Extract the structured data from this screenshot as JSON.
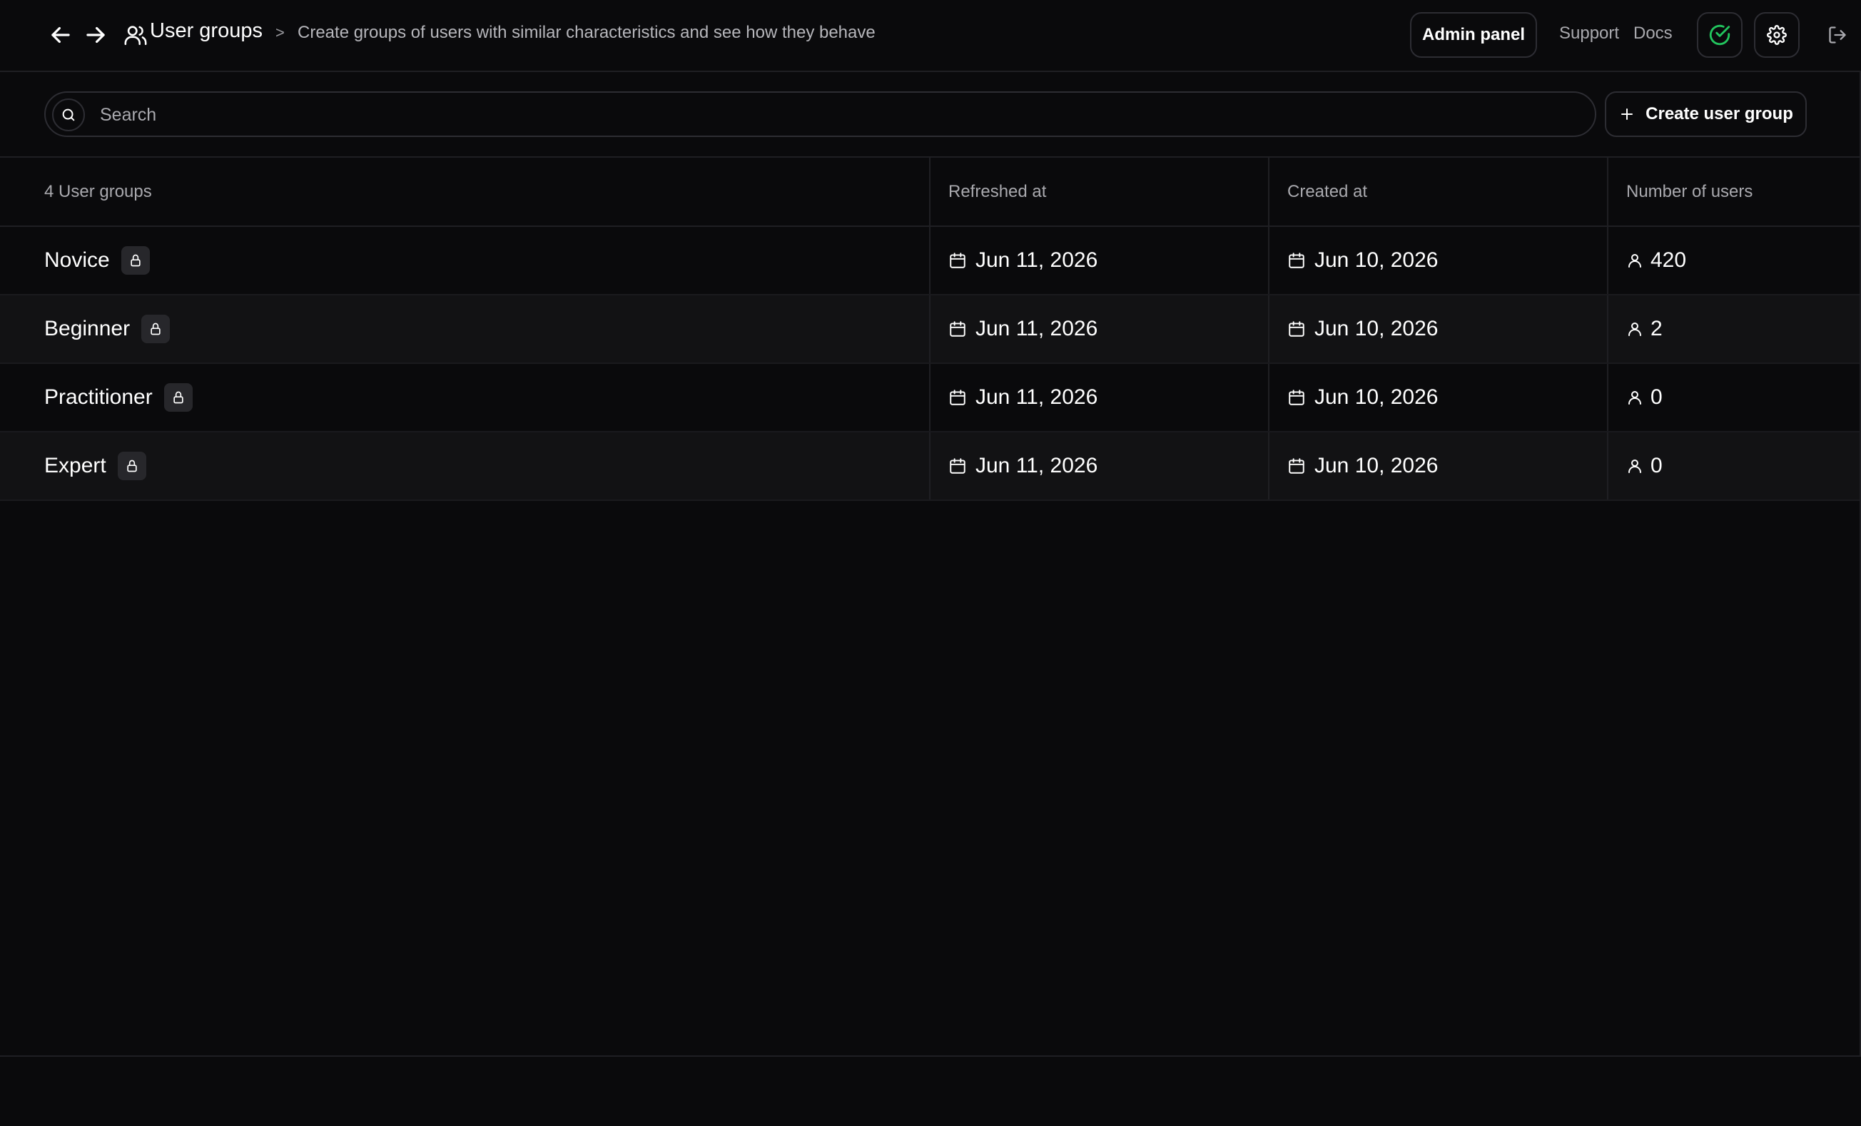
{
  "header": {
    "back_icon": "arrow-left-icon",
    "forward_icon": "arrow-right-icon",
    "section_icon": "users-icon",
    "title": "User groups",
    "separator": ">",
    "description": "Create groups of users with similar characteristics and see how they behave",
    "admin_panel_label": "Admin panel",
    "support_label": "Support",
    "docs_label": "Docs",
    "status_icon": "check-circle-icon",
    "settings_icon": "gear-icon",
    "logout_icon": "logout-icon"
  },
  "search": {
    "placeholder": "Search",
    "value": "",
    "create_label": "Create user group"
  },
  "table": {
    "columns": {
      "name": "4 User groups",
      "refreshed": "Refreshed at",
      "created": "Created at",
      "users": "Number of users"
    },
    "rows": [
      {
        "name": "Novice",
        "refreshed": "Jun 11, 2026",
        "created": "Jun 10, 2026",
        "users": "420"
      },
      {
        "name": "Beginner",
        "refreshed": "Jun 11, 2026",
        "created": "Jun 10, 2026",
        "users": "2"
      },
      {
        "name": "Practitioner",
        "refreshed": "Jun 11, 2026",
        "created": "Jun 10, 2026",
        "users": "0"
      },
      {
        "name": "Expert",
        "refreshed": "Jun 11, 2026",
        "created": "Jun 10, 2026",
        "users": "0"
      }
    ]
  },
  "colors": {
    "background": "#0a0a0c",
    "alt_row": "#121214",
    "border": "#1f1f23",
    "muted_text": "#a9a9ae",
    "status_green": "#22c55e"
  }
}
